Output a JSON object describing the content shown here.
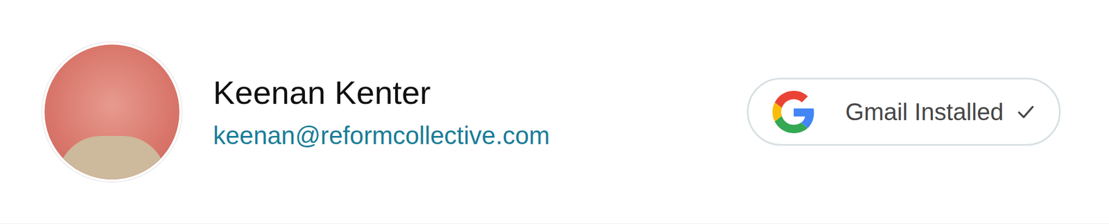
{
  "user": {
    "name": "Keenan Kenter",
    "email": "keenan@reformcollective.com"
  },
  "integration": {
    "label": "Gmail Installed",
    "installed": true
  }
}
